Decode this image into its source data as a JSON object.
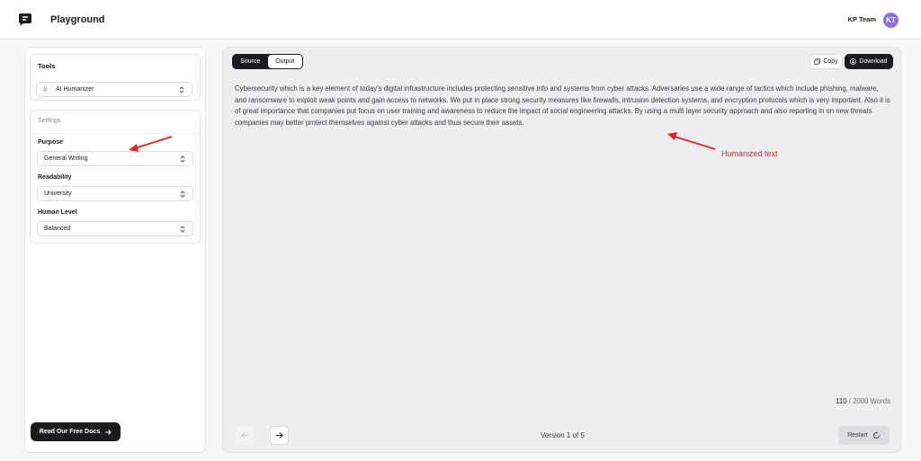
{
  "header": {
    "app_title": "Playground",
    "team_name": "KP Team",
    "avatar_initials": "KT",
    "avatar_color": "#8e6fe6"
  },
  "sidebar": {
    "tools_title": "Tools",
    "tool_selected": "AI Humanizer",
    "settings_title": "Settings",
    "purpose_label": "Purpose",
    "purpose_value": "General Writing",
    "readability_label": "Readability",
    "readability_value": "University",
    "human_level_label": "Human Level",
    "human_level_value": "Balanced",
    "docs_button_label": "Read Our Free Docs"
  },
  "panel": {
    "tabs": [
      {
        "label": "Source",
        "active": false
      },
      {
        "label": "Output",
        "active": true
      }
    ],
    "copy_label": "Copy",
    "download_label": "Download",
    "output_text": "Cybersecurity which is a key element of today's digital infrastructure includes protecting sensitive info and systems from cyber attacks. Adversaries use a wide range of tactics which include phishing, malware, and ransomware to exploit weak points and gain access to networks. We put in place strong security measures like firewalls, intrusion detection systems, and encryption protocols which is very important. Also it is of great importance that companies put focus on user training and awareness to reduce the impact of social engineering attacks. By using a multi layer security approach and also reporting in on new threats companies may better protect themselves against cyber attacks and thus secure their assets.",
    "word_count_current": "110",
    "word_count_rest": " / 2000 Words",
    "version_text": "Version 1 of 5",
    "restart_label": "Restart"
  },
  "annotations": {
    "humanized_label": "Humanized text",
    "arrow_color": "#e52222"
  }
}
